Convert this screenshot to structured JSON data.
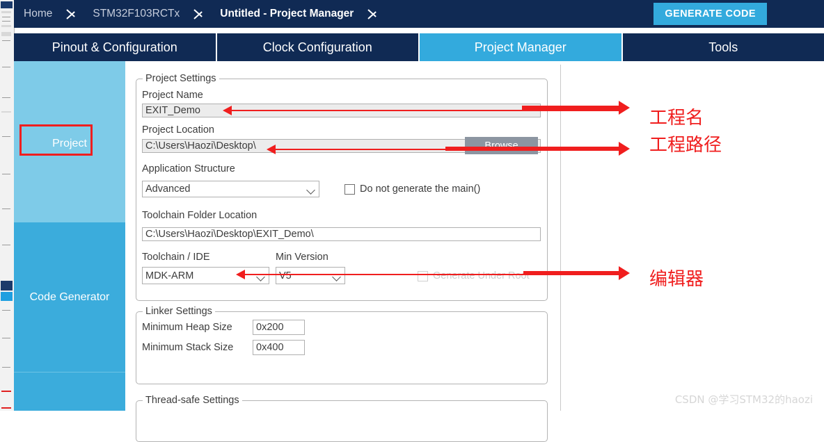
{
  "titlebar": {
    "crumbs": [
      {
        "label": "Home",
        "active": false
      },
      {
        "label": "STM32F103RCTx",
        "active": false
      },
      {
        "label": "Untitled - Project Manager",
        "active": true
      }
    ],
    "generate_code_label": "GENERATE CODE"
  },
  "tabs": [
    {
      "label": "Pinout & Configuration",
      "selected": false
    },
    {
      "label": "Clock Configuration",
      "selected": false
    },
    {
      "label": "Project Manager",
      "selected": true
    },
    {
      "label": "Tools",
      "selected": false
    }
  ],
  "sidebar": {
    "items": [
      {
        "label": "Project",
        "selected": true
      },
      {
        "label": "Code Generator",
        "selected": false
      },
      {
        "label": "",
        "selected": false
      }
    ]
  },
  "project_settings": {
    "legend": "Project Settings",
    "project_name_label": "Project Name",
    "project_name_value": "EXIT_Demo",
    "project_location_label": "Project Location",
    "project_location_value": "C:\\Users\\Haozi\\Desktop\\",
    "browse_label": "Browse",
    "application_structure_label": "Application Structure",
    "application_structure_value": "Advanced",
    "do_not_generate_main_label": "Do not generate the main()",
    "toolchain_folder_label": "Toolchain Folder Location",
    "toolchain_folder_value": "C:\\Users\\Haozi\\Desktop\\EXIT_Demo\\",
    "toolchain_ide_label": "Toolchain / IDE",
    "toolchain_ide_value": "MDK-ARM",
    "min_version_label": "Min Version",
    "min_version_value": "V5",
    "generate_under_root_label": "Generate Under Root"
  },
  "linker_settings": {
    "legend": "Linker Settings",
    "min_heap_label": "Minimum Heap Size",
    "min_heap_value": "0x200",
    "min_stack_label": "Minimum Stack Size",
    "min_stack_value": "0x400"
  },
  "thread_safe": {
    "legend": "Thread-safe Settings"
  },
  "annotations": {
    "project_name": "工程名",
    "project_path": "工程路径",
    "editor": "编辑器"
  },
  "watermark": "CSDN @学习STM32的haozi",
  "colors": {
    "navy": "#102a54",
    "accent_blue": "#33aadd",
    "sidebar_light": "#7ecbe8",
    "sidebar_dark": "#3bacdc",
    "annotation_red": "#f01e1e"
  }
}
